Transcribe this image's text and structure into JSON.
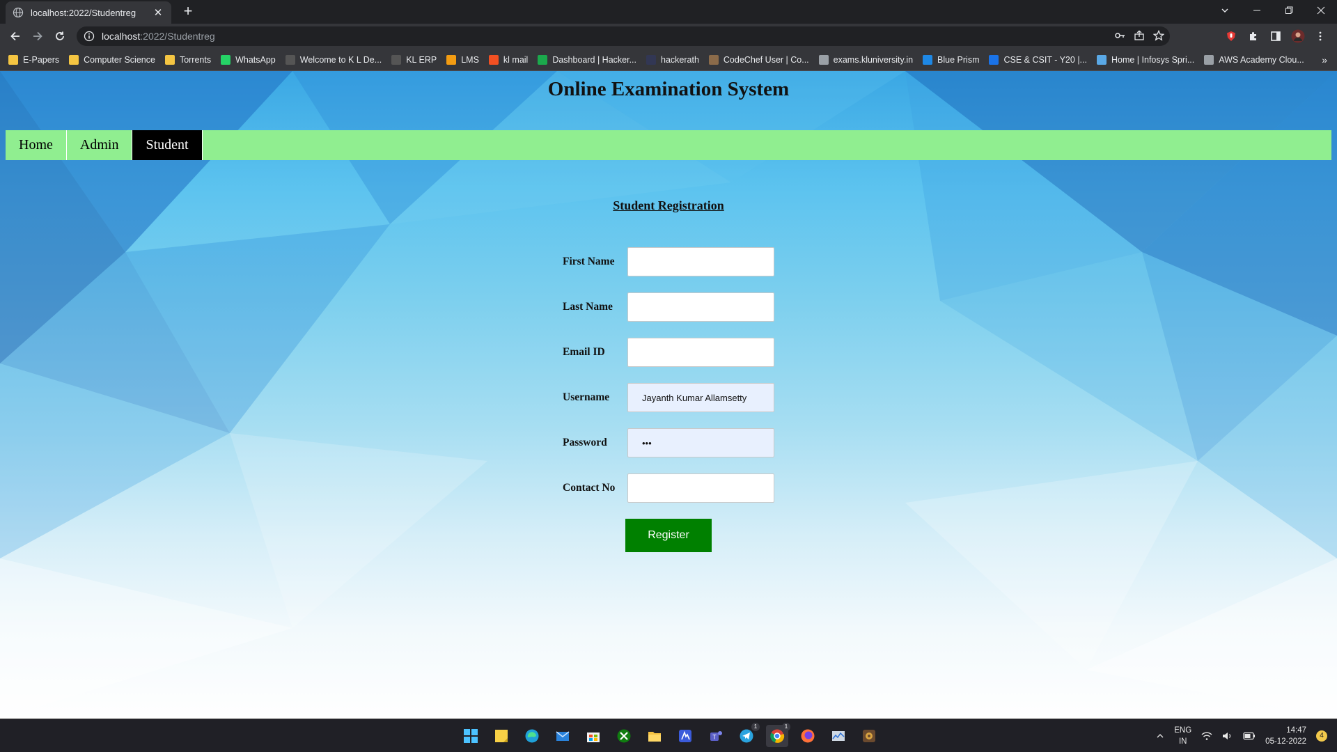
{
  "browser": {
    "tab_title": "localhost:2022/Studentreg",
    "tab_close": "✕",
    "new_tab": "+",
    "url_host": "localhost",
    "url_path": ":2022/Studentreg",
    "bookmarks": [
      {
        "label": "E-Papers",
        "icon": "folder-icon",
        "color": "#f4c542"
      },
      {
        "label": "Computer Science",
        "icon": "folder-icon",
        "color": "#f4c542"
      },
      {
        "label": "Torrents",
        "icon": "folder-icon",
        "color": "#f4c542"
      },
      {
        "label": "WhatsApp",
        "icon": "whatsapp-icon",
        "color": "#25d366"
      },
      {
        "label": "Welcome to K L De...",
        "icon": "kl-icon",
        "color": "#555555"
      },
      {
        "label": "KL ERP",
        "icon": "kl-icon",
        "color": "#555555"
      },
      {
        "label": "LMS",
        "icon": "lms-icon",
        "color": "#f39c12"
      },
      {
        "label": "kl mail",
        "icon": "microsoft-icon",
        "color": "#f25022"
      },
      {
        "label": "Dashboard | Hacker...",
        "icon": "hackerrank-icon",
        "color": "#1ba94c"
      },
      {
        "label": "hackerath",
        "icon": "hackerearth-icon",
        "color": "#323754"
      },
      {
        "label": "CodeChef User | Co...",
        "icon": "codechef-icon",
        "color": "#8b6b4a"
      },
      {
        "label": "exams.kluniversity.in",
        "icon": "globe-icon",
        "color": "#9aa0a6"
      },
      {
        "label": "Blue Prism",
        "icon": "blueprism-icon",
        "color": "#1e88e5"
      },
      {
        "label": "CSE & CSIT - Y20 |...",
        "icon": "c-icon",
        "color": "#1a73e8"
      },
      {
        "label": "Home | Infosys Spri...",
        "icon": "infosys-icon",
        "color": "#5aa9e6"
      },
      {
        "label": "AWS Academy Clou...",
        "icon": "aws-icon",
        "color": "#9aa0a6"
      }
    ],
    "bookmarks_more": "»"
  },
  "page": {
    "title": "Online Examination System",
    "menu": [
      {
        "label": "Home",
        "active": false
      },
      {
        "label": "Admin",
        "active": false
      },
      {
        "label": "Student",
        "active": true
      }
    ],
    "form_title": "Student Registration",
    "fields": [
      {
        "name": "first-name",
        "label": "First Name",
        "value": "",
        "type": "text"
      },
      {
        "name": "last-name",
        "label": "Last Name",
        "value": "",
        "type": "text"
      },
      {
        "name": "email-id",
        "label": "Email ID",
        "value": "",
        "type": "text"
      },
      {
        "name": "username",
        "label": "Username",
        "value": "Jayanth Kumar Allamsetty",
        "type": "text"
      },
      {
        "name": "password",
        "label": "Password",
        "value": "•••",
        "type": "text"
      },
      {
        "name": "contact-no",
        "label": "Contact No",
        "value": "",
        "type": "text"
      }
    ],
    "register_label": "Register",
    "accent": "#008000",
    "menu_bg": "#90ee90"
  },
  "taskbar": {
    "lang_line1": "ENG",
    "lang_line2": "IN",
    "time": "14:47",
    "date": "05-12-2022",
    "notifications": "4",
    "telegram_badge": "1",
    "chrome_badge": "1"
  }
}
